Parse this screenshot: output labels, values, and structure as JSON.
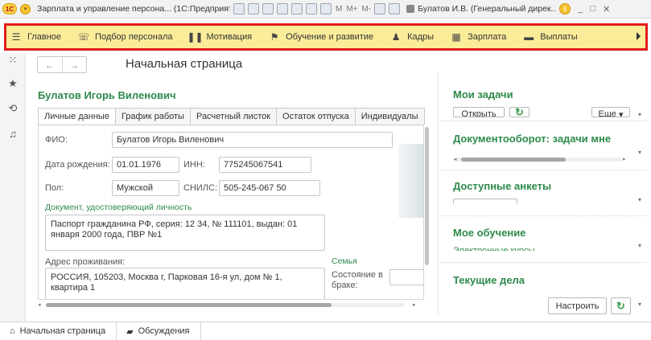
{
  "titlebar": {
    "logo": "1С",
    "app_title": "Зарплата и управление персона... (1С:Предприятие)",
    "memory_buttons": [
      "M",
      "M+",
      "M-"
    ],
    "user": "Булатов И.В. (Генеральный дирек...",
    "info": "i",
    "controls": [
      "_",
      "□",
      "✕"
    ]
  },
  "sections": {
    "items": [
      {
        "label": "Главное",
        "icon": "menu-icon",
        "glyph": "☰"
      },
      {
        "label": "Подбор персонала",
        "icon": "recruiting-icon",
        "glyph": "☏"
      },
      {
        "label": "Мотивация",
        "icon": "motivation-icon",
        "glyph": "❚❚"
      },
      {
        "label": "Обучение и развитие",
        "icon": "education-icon",
        "glyph": "⚑"
      },
      {
        "label": "Кадры",
        "icon": "people-icon",
        "glyph": "♟"
      },
      {
        "label": "Зарплата",
        "icon": "calculator-icon",
        "glyph": "▦"
      },
      {
        "label": "Выплаты",
        "icon": "payments-icon",
        "glyph": "▬"
      }
    ]
  },
  "toolstrip": {
    "icons": [
      "apps-grid-icon",
      "favorites-star-icon",
      "history-icon",
      "notifications-bell-icon"
    ]
  },
  "main": {
    "back": "←",
    "forward": "→",
    "title": "Начальная страница",
    "person_name": "Булатов Игорь Виленович",
    "tabs": [
      "Личные данные",
      "График работы",
      "Расчетный листок",
      "Остаток отпуска",
      "Индивидуалы"
    ],
    "form": {
      "fio_label": "ФИО:",
      "fio_value": "Булатов Игорь Виленович",
      "birth_label": "Дата рождения:",
      "birth_value": "01.01.1976",
      "inn_label": "ИНН:",
      "inn_value": "775245067541",
      "gender_label": "Пол:",
      "gender_value": "Мужской",
      "snils_label": "СНИЛС:",
      "snils_value": "505-245-067 50",
      "doc_section": "Документ, удостоверяющий личность",
      "doc_value": "Паспорт гражданина РФ, серия: 12 34, № 111101, выдан: 01 января 2000 года, ПВР №1",
      "address_label": "Адрес проживания:",
      "address_value": "РОССИЯ, 105203, Москва г, Парковая 16-я ул, дом № 1, квартира 1",
      "family_section": "Семья",
      "marital_label": "Состояние в браке:"
    }
  },
  "right_panel": {
    "tasks_title": "Мои задачи",
    "open_button": "Открыть",
    "more_button": "Еще",
    "docflow_title": "Документооборот: задачи мне",
    "surveys_title": "Доступные анкеты",
    "training_title": "Мое обучение",
    "training_link": "Электронные курсы",
    "current_title": "Текущие дела",
    "configure_button": "Настроить"
  },
  "bottombar": {
    "tabs": [
      {
        "label": "Начальная страница",
        "icon": "home-icon"
      },
      {
        "label": "Обсуждения",
        "icon": "discussions-icon"
      }
    ]
  }
}
